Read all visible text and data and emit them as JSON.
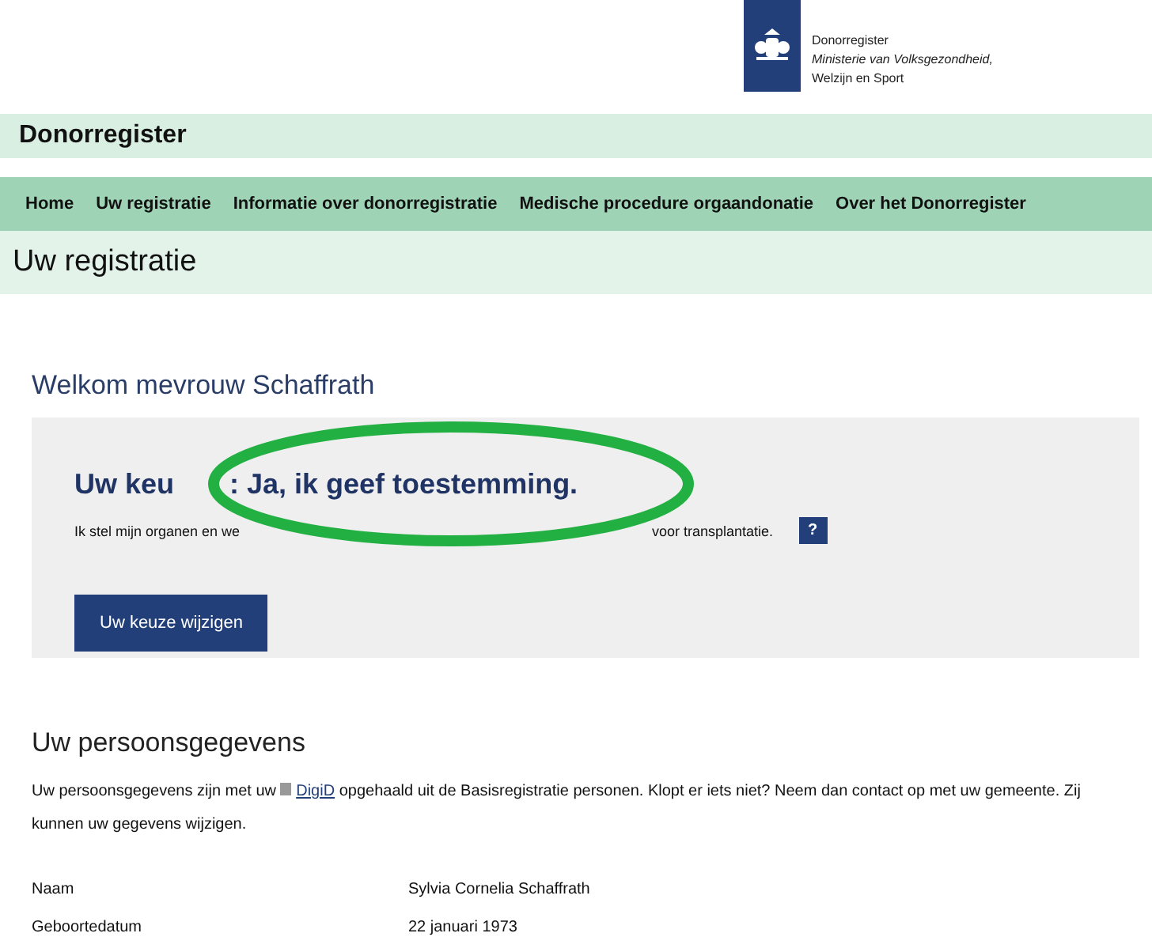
{
  "logo": {
    "lines": [
      "Donorregister",
      "Ministerie van Volksgezondheid,",
      "Welzijn en Sport"
    ]
  },
  "site_title": "Donorregister",
  "nav": [
    {
      "label": "Home"
    },
    {
      "label": "Uw registratie"
    },
    {
      "label": "Informatie over donorregistratie"
    },
    {
      "label": "Medische procedure orgaandonatie"
    },
    {
      "label": "Over het Donorregister"
    }
  ],
  "page_title": "Uw registratie",
  "welcome": "Welkom mevrouw Schaffrath",
  "choice": {
    "heading_start": "Uw keu",
    "heading_end": ": Ja, ik geef toestemming.",
    "text_start": "Ik stel mijn organen en we",
    "text_end": "voor transplantatie.",
    "help": "?",
    "button": "Uw keuze wijzigen"
  },
  "personal": {
    "heading": "Uw persoonsgegevens",
    "text_before": "Uw persoonsgegevens zijn met uw",
    "link": "DigiD",
    "text_after": "opgehaald uit de Basisregistratie personen. Klopt er iets niet? Neem dan contact op met uw gemeente. Zij kunnen uw gegevens wijzigen.",
    "rows": [
      {
        "label": "Naam",
        "value": "Sylvia Cornelia Schaffrath"
      },
      {
        "label": "Geboortedatum",
        "value": "22 januari 1973"
      }
    ]
  }
}
